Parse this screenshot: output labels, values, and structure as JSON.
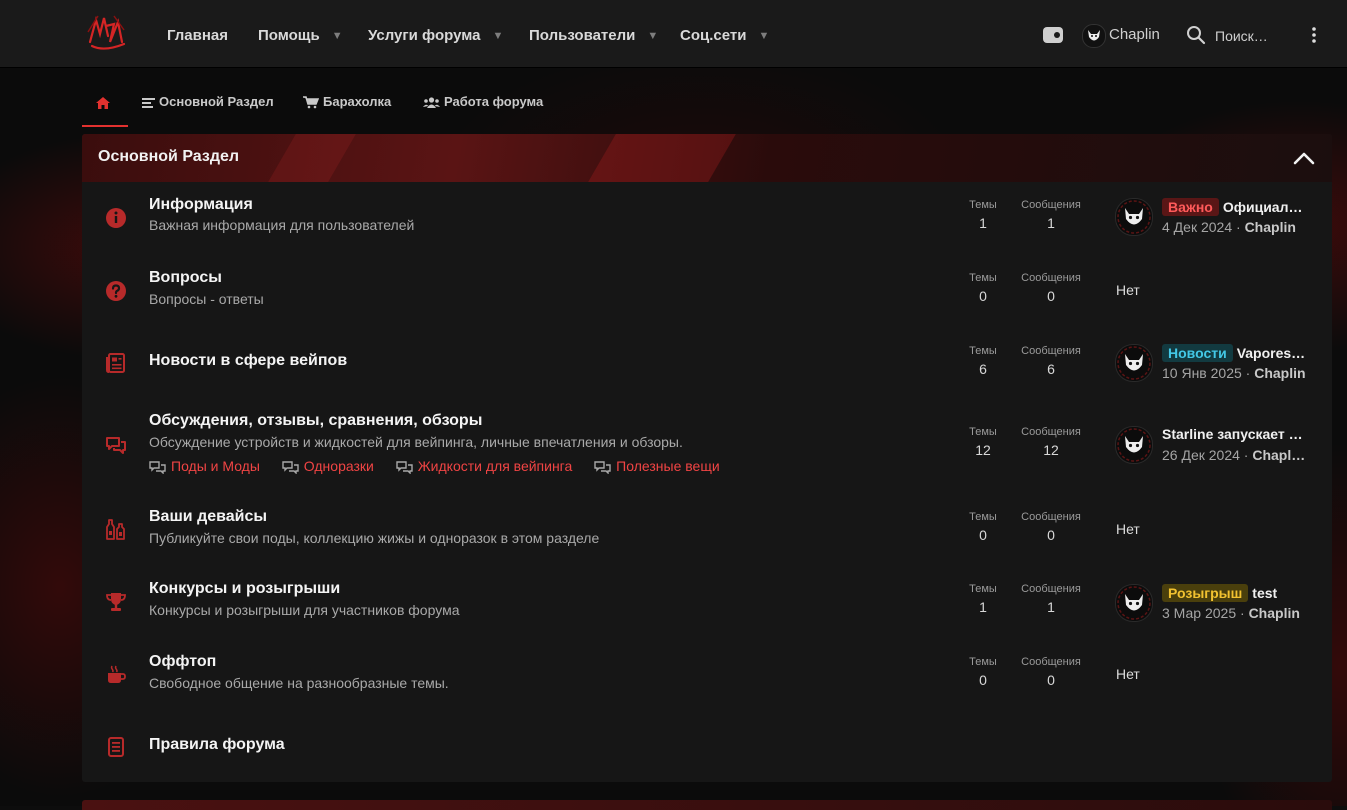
{
  "nav": {
    "items": [
      {
        "label": "Главная",
        "dropdown": false
      },
      {
        "label": "Помощь",
        "dropdown": true
      },
      {
        "label": "Услуги форума",
        "dropdown": true
      },
      {
        "label": "Пользователи",
        "dropdown": true
      },
      {
        "label": "Соц.сети",
        "dropdown": true
      }
    ],
    "caret": "▼",
    "username": "Chaplin",
    "search_label": "Поиск…"
  },
  "tabs": [
    {
      "label": "",
      "icon": "home-icon"
    },
    {
      "label": "Основной Раздел",
      "icon": "list-icon"
    },
    {
      "label": "Барахолка",
      "icon": "cart-icon"
    },
    {
      "label": "Работа форума",
      "icon": "users-icon"
    }
  ],
  "section": {
    "title": "Основной Раздел",
    "stat_labels": {
      "themes": "Темы",
      "messages": "Сообщения"
    },
    "none_label": "Нет",
    "nodes": [
      {
        "title": "Информация",
        "desc": "Важная информация для пользователей",
        "icon": "info-icon",
        "themes": "1",
        "messages": "1",
        "latest": {
          "badge": "Важно",
          "badge_color": "#ff5a5a",
          "title": "Официал…",
          "date": "4 Дек 2024",
          "author": "Chaplin"
        }
      },
      {
        "title": "Вопросы",
        "desc": "Вопросы - ответы",
        "icon": "question-icon",
        "themes": "0",
        "messages": "0",
        "latest": null
      },
      {
        "title": "Новости в сфере вейпов",
        "desc": "",
        "icon": "newspaper-icon",
        "themes": "6",
        "messages": "6",
        "latest": {
          "badge": "Новости",
          "badge_color": "#43c8e6",
          "title": "Vapores…",
          "date": "10 Янв 2025",
          "author": "Chaplin"
        }
      },
      {
        "title": "Обсуждения, отзывы, сравнения, обзоры",
        "desc": "Обсуждение устройств и жидкостей для вейпинга, личные впечатления и обзоры.",
        "icon": "comments-icon",
        "themes": "12",
        "messages": "12",
        "subforums": [
          "Поды и Моды",
          "Одноразки",
          "Жидкости для вейпинга",
          "Полезные вещи"
        ],
        "latest": {
          "badge": "",
          "badge_color": "",
          "title": "Starline запускает …",
          "date": "26 Дек 2024",
          "author": "Chapl…"
        }
      },
      {
        "title": "Ваши девайсы",
        "desc": "Публикуйте свои поды, коллекцию жижы и одноразок в этом разделе",
        "icon": "bottles-icon",
        "themes": "0",
        "messages": "0",
        "latest": null
      },
      {
        "title": "Конкурсы и розыгрыши",
        "desc": "Конкурсы и розыгрыши для участников форума",
        "icon": "trophy-icon",
        "themes": "1",
        "messages": "1",
        "latest": {
          "badge": "Розыгрыш",
          "badge_color": "#f2c230",
          "title": "test",
          "date": "3 Мар 2025",
          "author": "Chaplin"
        }
      },
      {
        "title": "Оффтоп",
        "desc": "Свободное общение на разнообразные темы.",
        "icon": "coffee-icon",
        "themes": "0",
        "messages": "0",
        "latest": null
      },
      {
        "title": "Правила форума",
        "desc": "",
        "icon": "book-icon",
        "themes": null,
        "messages": null,
        "latest": null
      }
    ]
  },
  "colors": {
    "accent": "#e3312f",
    "link": "#f04444",
    "bg": "#0d0d0d",
    "block": "#161616"
  }
}
